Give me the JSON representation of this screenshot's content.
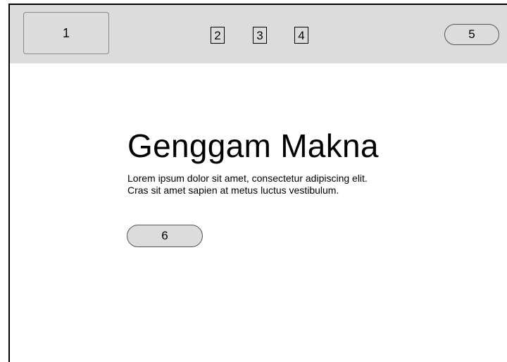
{
  "header": {
    "logo_label": "1",
    "nav_items": [
      {
        "label": "2"
      },
      {
        "label": "3"
      },
      {
        "label": "4"
      }
    ],
    "cta_label": "5"
  },
  "hero": {
    "title": "Genggam Makna",
    "body": "Lorem ipsum dolor sit amet, consectetur adipiscing elit. Cras sit amet sapien at metus luctus vestibulum.",
    "button_label": "6"
  },
  "colors": {
    "header_bg": "#dcdcdc",
    "page_bg": "#ffffff",
    "border": "#000000"
  }
}
